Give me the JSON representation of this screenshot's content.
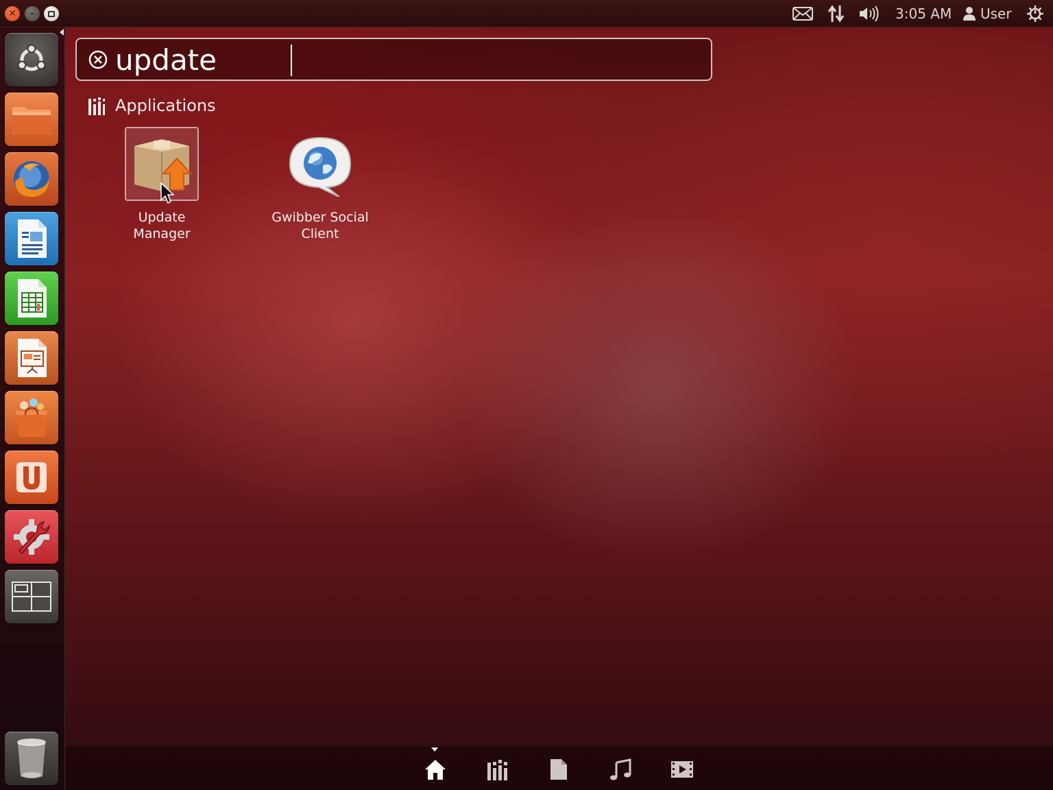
{
  "top_panel": {
    "clock": "3:05 AM",
    "user": "User",
    "icons": [
      "mail-icon",
      "network-icon",
      "volume-icon",
      "user-icon",
      "power-gear-icon"
    ]
  },
  "launcher": {
    "items": [
      {
        "name": "dash-home-button",
        "icon": "ubuntu-logo-icon"
      },
      {
        "name": "files-launcher",
        "icon": "folder-icon"
      },
      {
        "name": "firefox-launcher",
        "icon": "firefox-icon"
      },
      {
        "name": "writer-launcher",
        "icon": "writer-document-icon"
      },
      {
        "name": "calc-launcher",
        "icon": "spreadsheet-icon"
      },
      {
        "name": "impress-launcher",
        "icon": "presentation-icon"
      },
      {
        "name": "software-center-launcher",
        "icon": "shopping-bag-icon"
      },
      {
        "name": "ubuntu-one-launcher",
        "icon": "ubuntu-one-icon"
      },
      {
        "name": "system-settings-launcher",
        "icon": "settings-wrench-icon"
      },
      {
        "name": "workspace-switcher-launcher",
        "icon": "workspace-icon"
      },
      {
        "name": "trash-launcher",
        "icon": "trash-icon"
      }
    ]
  },
  "search": {
    "value": "update"
  },
  "results": {
    "category": "Applications",
    "items": [
      {
        "label_line1": "Update",
        "label_line2": "Manager",
        "icon": "package-update-icon"
      },
      {
        "label_line1": "Gwibber Social",
        "label_line2": "Client",
        "icon": "gwibber-globe-icon"
      }
    ]
  },
  "lens_bar": {
    "lenses": [
      "home-lens-icon",
      "applications-lens-icon",
      "files-lens-icon",
      "music-lens-icon",
      "video-lens-icon"
    ],
    "active": "home-lens-icon"
  },
  "colors": {
    "accent_orange": "#dd4814",
    "dash_red": "#8a2224"
  }
}
